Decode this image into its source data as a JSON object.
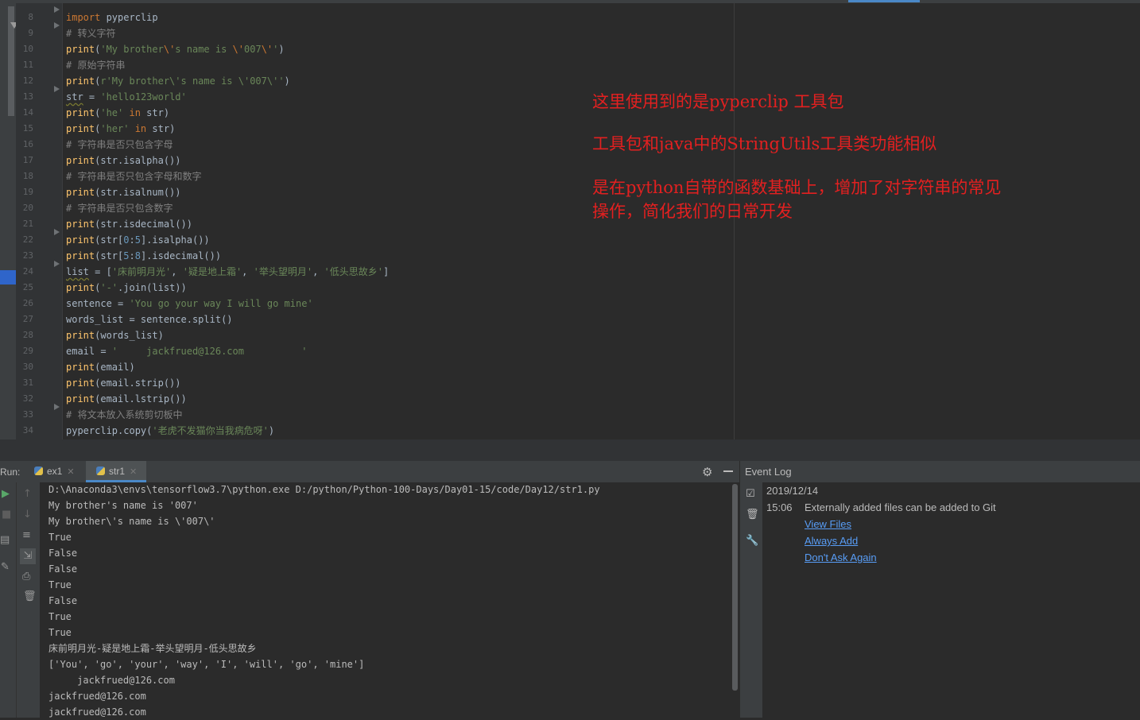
{
  "editor": {
    "line_numbers": [
      "8",
      "9",
      "10",
      "11",
      "12",
      "13",
      "14",
      "15",
      "16",
      "17",
      "18",
      "19",
      "20",
      "21",
      "22",
      "23",
      "24",
      "25",
      "26",
      "27",
      "28",
      "29",
      "30",
      "31",
      "32",
      "33",
      "34"
    ],
    "lines": [
      [
        {
          "t": "import",
          "c": "kw"
        },
        {
          "t": " pyperclip",
          "c": ""
        }
      ],
      [
        {
          "t": "# 转义字符",
          "c": "cm"
        }
      ],
      [
        {
          "t": "print",
          "c": "fn"
        },
        {
          "t": "(",
          "c": ""
        },
        {
          "t": "'My brother",
          "c": "st"
        },
        {
          "t": "\\'",
          "c": "esc"
        },
        {
          "t": "s name is ",
          "c": "st"
        },
        {
          "t": "\\'",
          "c": "esc"
        },
        {
          "t": "007",
          "c": "st"
        },
        {
          "t": "\\'",
          "c": "esc"
        },
        {
          "t": "'",
          "c": "st"
        },
        {
          "t": ")",
          "c": ""
        }
      ],
      [
        {
          "t": "# 原始字符串",
          "c": "cm"
        }
      ],
      [
        {
          "t": "print",
          "c": "fn"
        },
        {
          "t": "(",
          "c": ""
        },
        {
          "t": "r'My brother\\'s name is \\'007\\''",
          "c": "st"
        },
        {
          "t": ")",
          "c": ""
        }
      ],
      [
        {
          "t": "str",
          "c": "wavy"
        },
        {
          "t": " = ",
          "c": ""
        },
        {
          "t": "'hello123world'",
          "c": "st"
        }
      ],
      [
        {
          "t": "print",
          "c": "fn"
        },
        {
          "t": "(",
          "c": ""
        },
        {
          "t": "'he'",
          "c": "st"
        },
        {
          "t": " in ",
          "c": "kw"
        },
        {
          "t": "str)",
          "c": ""
        }
      ],
      [
        {
          "t": "print",
          "c": "fn"
        },
        {
          "t": "(",
          "c": ""
        },
        {
          "t": "'her'",
          "c": "st"
        },
        {
          "t": " in ",
          "c": "kw"
        },
        {
          "t": "str)",
          "c": ""
        }
      ],
      [
        {
          "t": "# 字符串是否只包含字母",
          "c": "cm"
        }
      ],
      [
        {
          "t": "print",
          "c": "fn"
        },
        {
          "t": "(str.isalpha())",
          "c": ""
        }
      ],
      [
        {
          "t": "# 字符串是否只包含字母和数字",
          "c": "cm"
        }
      ],
      [
        {
          "t": "print",
          "c": "fn"
        },
        {
          "t": "(str.isalnum())",
          "c": ""
        }
      ],
      [
        {
          "t": "# 字符串是否只包含数字",
          "c": "cm"
        }
      ],
      [
        {
          "t": "print",
          "c": "fn"
        },
        {
          "t": "(str.isdecimal())",
          "c": ""
        }
      ],
      [
        {
          "t": "print",
          "c": "fn"
        },
        {
          "t": "(str[",
          "c": ""
        },
        {
          "t": "0",
          "c": "num"
        },
        {
          "t": ":",
          "c": ""
        },
        {
          "t": "5",
          "c": "num"
        },
        {
          "t": "].isalpha())",
          "c": ""
        }
      ],
      [
        {
          "t": "print",
          "c": "fn"
        },
        {
          "t": "(str[",
          "c": ""
        },
        {
          "t": "5",
          "c": "num"
        },
        {
          "t": ":",
          "c": ""
        },
        {
          "t": "8",
          "c": "num"
        },
        {
          "t": "].isdecimal())",
          "c": ""
        }
      ],
      [
        {
          "t": "list",
          "c": "wavy"
        },
        {
          "t": " = [",
          "c": ""
        },
        {
          "t": "'床前明月光'",
          "c": "st"
        },
        {
          "t": ", ",
          "c": ""
        },
        {
          "t": "'疑是地上霜'",
          "c": "st"
        },
        {
          "t": ", ",
          "c": ""
        },
        {
          "t": "'举头望明月'",
          "c": "st"
        },
        {
          "t": ", ",
          "c": ""
        },
        {
          "t": "'低头思故乡'",
          "c": "st"
        },
        {
          "t": "]",
          "c": ""
        }
      ],
      [
        {
          "t": "print",
          "c": "fn"
        },
        {
          "t": "(",
          "c": ""
        },
        {
          "t": "'-'",
          "c": "st"
        },
        {
          "t": ".join(list))",
          "c": ""
        }
      ],
      [
        {
          "t": "sentence = ",
          "c": ""
        },
        {
          "t": "'You go your way I will go mine'",
          "c": "st"
        }
      ],
      [
        {
          "t": "words_list = sentence.split()",
          "c": ""
        }
      ],
      [
        {
          "t": "print",
          "c": "fn"
        },
        {
          "t": "(words_list)",
          "c": ""
        }
      ],
      [
        {
          "t": "email = ",
          "c": ""
        },
        {
          "t": "'     jackfrued@126.com          '",
          "c": "st"
        }
      ],
      [
        {
          "t": "print",
          "c": "fn"
        },
        {
          "t": "(email)",
          "c": ""
        }
      ],
      [
        {
          "t": "print",
          "c": "fn"
        },
        {
          "t": "(email.strip())",
          "c": ""
        }
      ],
      [
        {
          "t": "print",
          "c": "fn"
        },
        {
          "t": "(email.lstrip())",
          "c": ""
        }
      ],
      [
        {
          "t": "# 将文本放入系统剪切板中",
          "c": "cm"
        }
      ],
      [
        {
          "t": "pyperclip.copy(",
          "c": ""
        },
        {
          "t": "'老虎不发猫你当我病危呀'",
          "c": "st"
        },
        {
          "t": ")",
          "c": ""
        }
      ]
    ]
  },
  "annotation": {
    "line1": "这里使用到的是pyperclip 工具包",
    "line2": "工具包和java中的StringUtils工具类功能相似",
    "line3a": "是在python自带的函数基础上，增加了对字符串的常见",
    "line3b": "操作，简化我们的日常开发"
  },
  "run_panel": {
    "label": "Run:",
    "tabs": [
      {
        "label": "ex1"
      },
      {
        "label": "str1"
      }
    ],
    "close_glyph": "✕",
    "output": [
      "D:\\Anaconda3\\envs\\tensorflow3.7\\python.exe D:/python/Python-100-Days/Day01-15/code/Day12/str1.py",
      "My brother's name is '007'",
      "My brother\\'s name is \\'007\\'",
      "True",
      "False",
      "False",
      "True",
      "False",
      "True",
      "True",
      "床前明月光-疑是地上霜-举头望明月-低头思故乡",
      "['You', 'go', 'your', 'way', 'I', 'will', 'go', 'mine']",
      "     jackfrued@126.com          ",
      "jackfrued@126.com",
      "jackfrued@126.com"
    ]
  },
  "event_log": {
    "title": "Event Log",
    "date": "2019/12/14",
    "time": "15:06",
    "message": "Externally added files can be added to Git",
    "links": [
      "View Files",
      "Always Add",
      "Don't Ask Again"
    ]
  },
  "colors": {
    "background": "#2b2b2b",
    "keyword": "#cc7832",
    "function": "#ffc66d",
    "string": "#6a8759",
    "comment": "#808080",
    "annotation": "#e32020",
    "link": "#589df6",
    "accent": "#4a88c7"
  }
}
